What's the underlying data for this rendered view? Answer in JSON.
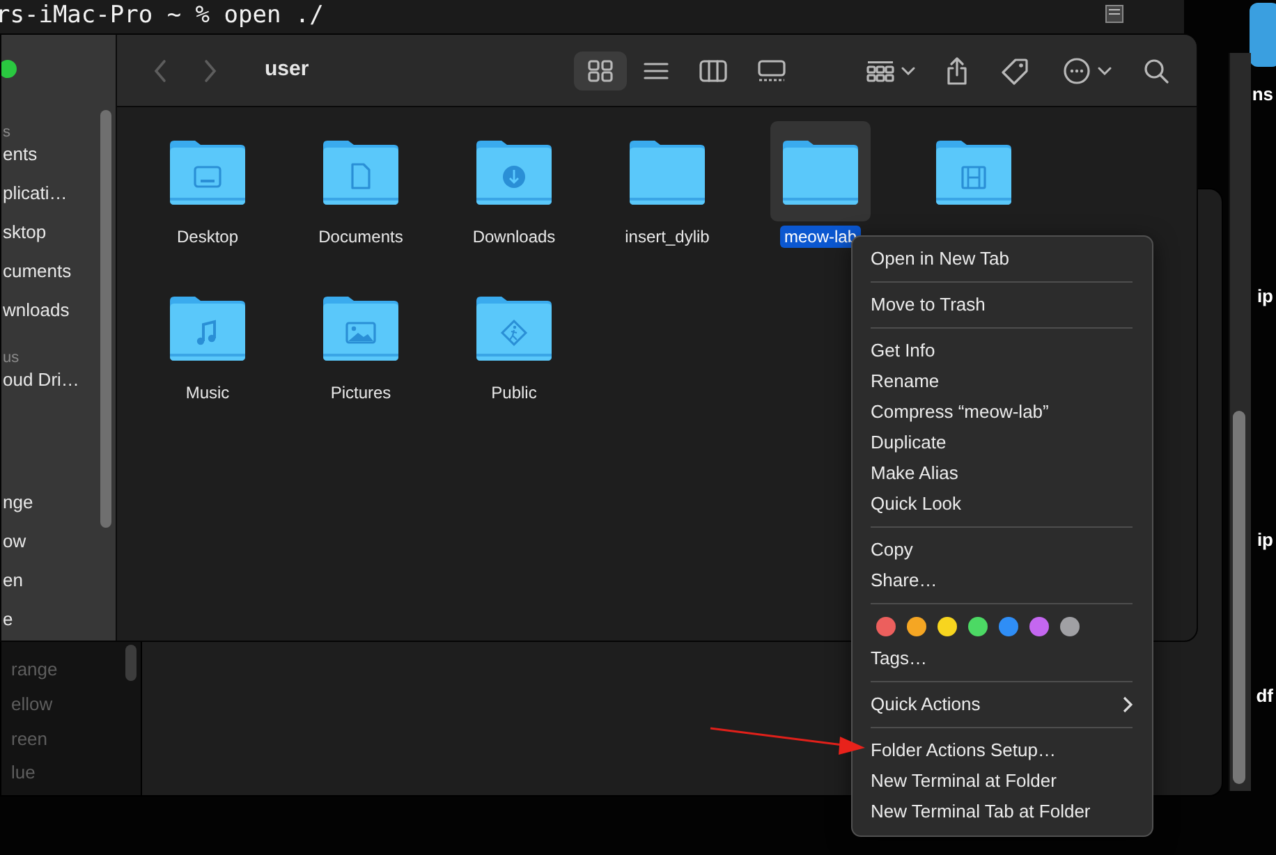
{
  "terminal": {
    "command_line": "rs-iMac-Pro ~ % open ./"
  },
  "back_window": {
    "sidebar": [
      {
        "label": "range"
      },
      {
        "label": "ellow"
      },
      {
        "label": "reen"
      },
      {
        "label": "lue"
      }
    ]
  },
  "finder": {
    "title": "user",
    "view_modes": [
      {
        "kind": "icons",
        "selected": true
      },
      {
        "kind": "list",
        "selected": false
      },
      {
        "kind": "columns",
        "selected": false
      },
      {
        "kind": "gallery",
        "selected": false
      }
    ],
    "sidebar": [
      {
        "kind": "header",
        "label": "s"
      },
      {
        "kind": "item",
        "label": "ents"
      },
      {
        "kind": "item",
        "label": "plicati…"
      },
      {
        "kind": "item",
        "label": "sktop"
      },
      {
        "kind": "item",
        "label": "cuments"
      },
      {
        "kind": "item",
        "label": "wnloads"
      },
      {
        "kind": "header",
        "label": "us"
      },
      {
        "kind": "item",
        "label": "oud Dri…"
      },
      {
        "kind": "gap"
      },
      {
        "kind": "item",
        "label": "nge"
      },
      {
        "kind": "item",
        "label": "ow"
      },
      {
        "kind": "item",
        "label": "en"
      },
      {
        "kind": "item",
        "label": "e"
      }
    ],
    "files": [
      {
        "kind": "desktop",
        "label": "Desktop",
        "selected": false
      },
      {
        "kind": "document",
        "label": "Documents",
        "selected": false
      },
      {
        "kind": "download",
        "label": "Downloads",
        "selected": false
      },
      {
        "kind": "plain",
        "label": "insert_dylib",
        "selected": false
      },
      {
        "kind": "plain",
        "label": "meow-lab",
        "selected": true
      },
      {
        "kind": "film",
        "selected": false
      },
      {
        "kind": "music",
        "label": "Music",
        "selected": false
      },
      {
        "kind": "picture",
        "label": "Pictures",
        "selected": false
      },
      {
        "kind": "public",
        "label": "Public",
        "selected": false
      }
    ]
  },
  "context_menu": {
    "sections": [
      {
        "items": [
          {
            "kind": "item",
            "label": "Open in New Tab"
          }
        ]
      },
      {
        "items": [
          {
            "kind": "item",
            "label": "Move to Trash"
          }
        ]
      },
      {
        "items": [
          {
            "kind": "item",
            "label": "Get Info"
          },
          {
            "kind": "item",
            "label": "Rename"
          },
          {
            "kind": "item",
            "label": "Compress “meow-lab”"
          },
          {
            "kind": "item",
            "label": "Duplicate"
          },
          {
            "kind": "item",
            "label": "Make Alias"
          },
          {
            "kind": "item",
            "label": "Quick Look"
          }
        ]
      },
      {
        "items": [
          {
            "kind": "item",
            "label": "Copy"
          },
          {
            "kind": "item",
            "label": "Share…"
          }
        ]
      },
      {
        "items": [
          {
            "kind": "tags",
            "tags": [
              {
                "color": "#ec5f5d"
              },
              {
                "color": "#f5a623"
              },
              {
                "color": "#f7d51f"
              },
              {
                "color": "#4cd964"
              },
              {
                "color": "#2f8ef6"
              },
              {
                "color": "#c467f0"
              },
              {
                "color": "#a0a0a4"
              }
            ]
          },
          {
            "kind": "item",
            "label": "Tags…"
          }
        ]
      },
      {
        "items": [
          {
            "kind": "submenu",
            "label": "Quick Actions"
          }
        ]
      },
      {
        "items": [
          {
            "kind": "item",
            "label": "Folder Actions Setup…"
          },
          {
            "kind": "item",
            "label": "New Terminal at Folder"
          },
          {
            "kind": "item",
            "label": "New Terminal Tab at Folder"
          }
        ]
      }
    ]
  },
  "desktop_labels": [
    {
      "label": "ns"
    },
    {
      "label": "ip"
    },
    {
      "label": "ip"
    },
    {
      "label": "df"
    }
  ]
}
